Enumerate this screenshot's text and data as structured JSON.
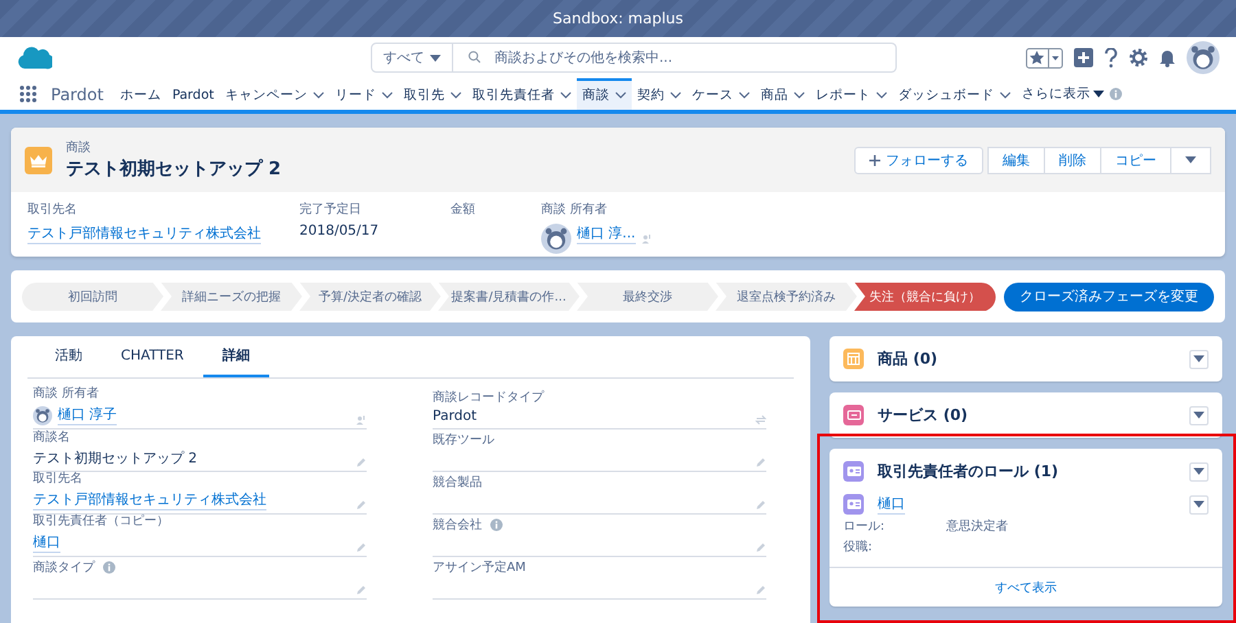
{
  "banner": {
    "text": "Sandbox: maplus"
  },
  "header": {
    "scope": "すべて",
    "search_placeholder": "商談およびその他を検索中..."
  },
  "nav": {
    "app_name": "Pardot",
    "items": [
      {
        "label": "ホーム",
        "has_menu": false,
        "selected": false
      },
      {
        "label": "Pardot",
        "has_menu": false,
        "selected": false
      },
      {
        "label": "キャンペーン",
        "has_menu": true,
        "selected": false
      },
      {
        "label": "リード",
        "has_menu": true,
        "selected": false
      },
      {
        "label": "取引先",
        "has_menu": true,
        "selected": false
      },
      {
        "label": "取引先責任者",
        "has_menu": true,
        "selected": false
      },
      {
        "label": "商談",
        "has_menu": true,
        "selected": true
      },
      {
        "label": "契約",
        "has_menu": true,
        "selected": false
      },
      {
        "label": "ケース",
        "has_menu": true,
        "selected": false
      },
      {
        "label": "商品",
        "has_menu": true,
        "selected": false
      },
      {
        "label": "レポート",
        "has_menu": true,
        "selected": false
      },
      {
        "label": "ダッシュボード",
        "has_menu": true,
        "selected": false
      }
    ],
    "more": "さらに表示"
  },
  "record": {
    "object_label": "商談",
    "title": "テスト初期セットアップ 2",
    "follow": "フォローする",
    "actions": [
      "編集",
      "削除",
      "コピー"
    ],
    "fields": [
      {
        "label": "取引先名",
        "value": "テスト戸部情報セキュリティ株式会社",
        "kind": "link"
      },
      {
        "label": "完了予定日",
        "value": "2018/05/17",
        "kind": "text"
      },
      {
        "label": "金額",
        "kind": "empty"
      },
      {
        "label": "商談 所有者",
        "value": "樋口 淳...",
        "kind": "user"
      }
    ]
  },
  "path": {
    "steps": [
      {
        "label": "初回訪問",
        "selected": false
      },
      {
        "label": "詳細ニーズの把握",
        "selected": false
      },
      {
        "label": "予算/決定者の確認",
        "selected": false
      },
      {
        "label": "提案書/見積書の作...",
        "selected": false
      },
      {
        "label": "最終交渉",
        "selected": false
      },
      {
        "label": "退室点検予約済み",
        "selected": false
      },
      {
        "label": "失注（競合に負け）",
        "selected": true
      }
    ],
    "button": "クローズ済みフェーズを変更"
  },
  "tabs": [
    {
      "label": "活動",
      "selected": false
    },
    {
      "label": "CHATTER",
      "selected": false
    },
    {
      "label": "詳細",
      "selected": true
    }
  ],
  "details": {
    "left": [
      {
        "label": "商談 所有者",
        "value": "樋口 淳子",
        "kind": "user",
        "info": false,
        "editable": false
      },
      {
        "label": "商談名",
        "value": "テスト初期セットアップ 2",
        "kind": "text",
        "info": false,
        "editable": true
      },
      {
        "label": "取引先名",
        "value": "テスト戸部情報セキュリティ株式会社",
        "kind": "link",
        "info": false,
        "editable": true
      },
      {
        "label": "取引先責任者（コピー）",
        "value": "樋口",
        "kind": "link",
        "info": false,
        "editable": true
      },
      {
        "label": "商談タイプ",
        "kind": "empty",
        "info": true,
        "editable": true
      }
    ],
    "right": [
      {
        "label": "商談レコードタイプ",
        "value": "Pardot",
        "kind": "text",
        "info": false,
        "editable": false
      },
      {
        "label": "既存ツール",
        "kind": "empty",
        "info": false,
        "editable": true
      },
      {
        "label": "競合製品",
        "kind": "empty",
        "info": false,
        "editable": true
      },
      {
        "label": "競合会社",
        "kind": "empty",
        "info": true,
        "editable": true
      },
      {
        "label": "アサイン予定AM",
        "kind": "empty",
        "info": false,
        "editable": true
      }
    ]
  },
  "related": [
    {
      "title": "商品 (0)",
      "kind": "product",
      "color": "#fcb95b"
    },
    {
      "title": "サービス (0)",
      "kind": "service",
      "color": "#e56798"
    },
    {
      "title": "取引先責任者のロール (1)",
      "kind": "roles",
      "color": "#a094ed",
      "contact": "樋口",
      "rows": [
        {
          "label": "ロール:",
          "value": "意思決定者"
        },
        {
          "label": "役職:"
        }
      ],
      "footer": "すべて表示"
    }
  ]
}
